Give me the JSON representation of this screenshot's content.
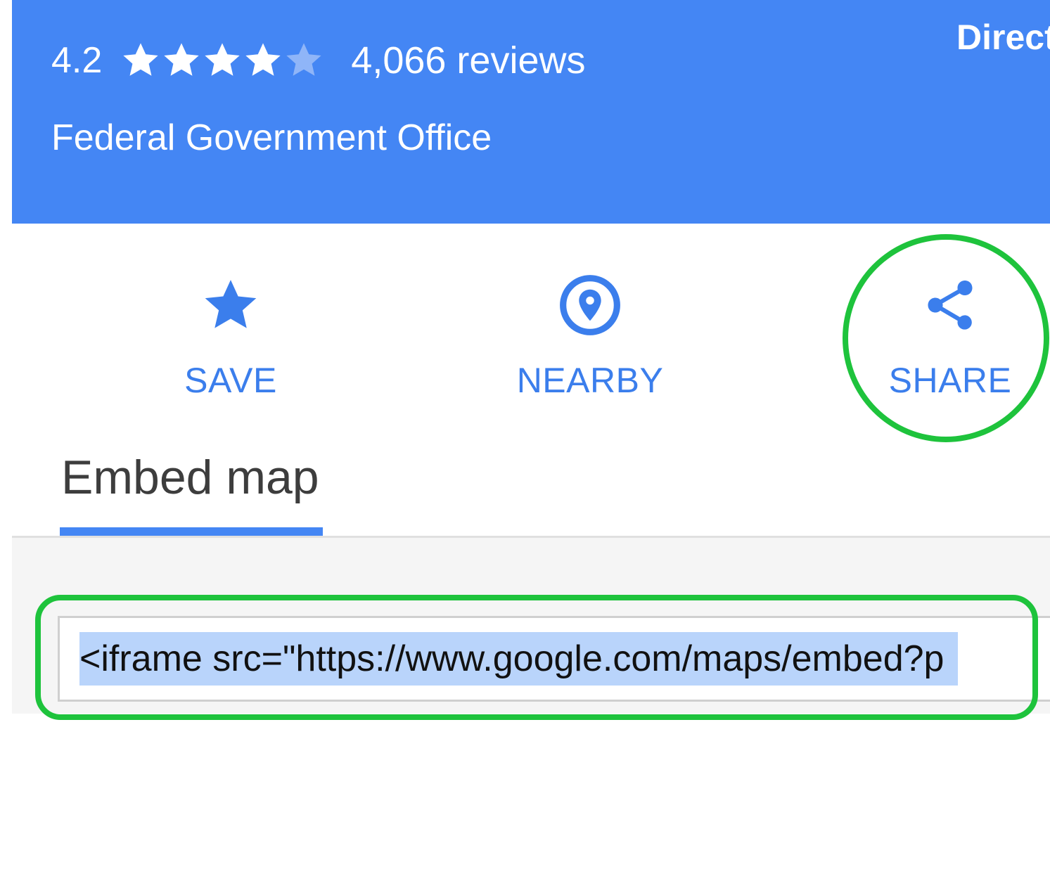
{
  "place": {
    "rating": "4.2",
    "stars_filled": 4,
    "stars_total": 5,
    "reviews": "4,066 reviews",
    "category": "Federal Government Office",
    "directions_label": "Direct"
  },
  "actions": {
    "save_label": "SAVE",
    "nearby_label": "NEARBY",
    "share_label": "SHARE"
  },
  "tabs": {
    "embed_label": "Embed map"
  },
  "embed": {
    "code_value": "<iframe src=\"https://www.google.com/maps/embed?p"
  },
  "colors": {
    "header_blue": "#4486f4",
    "action_blue": "#3b7eec",
    "highlight": "#b9d4fb",
    "annotation_green": "#1ec33c"
  },
  "icons": {
    "save": "star-icon",
    "nearby": "location-target-icon",
    "share": "share-icon"
  }
}
